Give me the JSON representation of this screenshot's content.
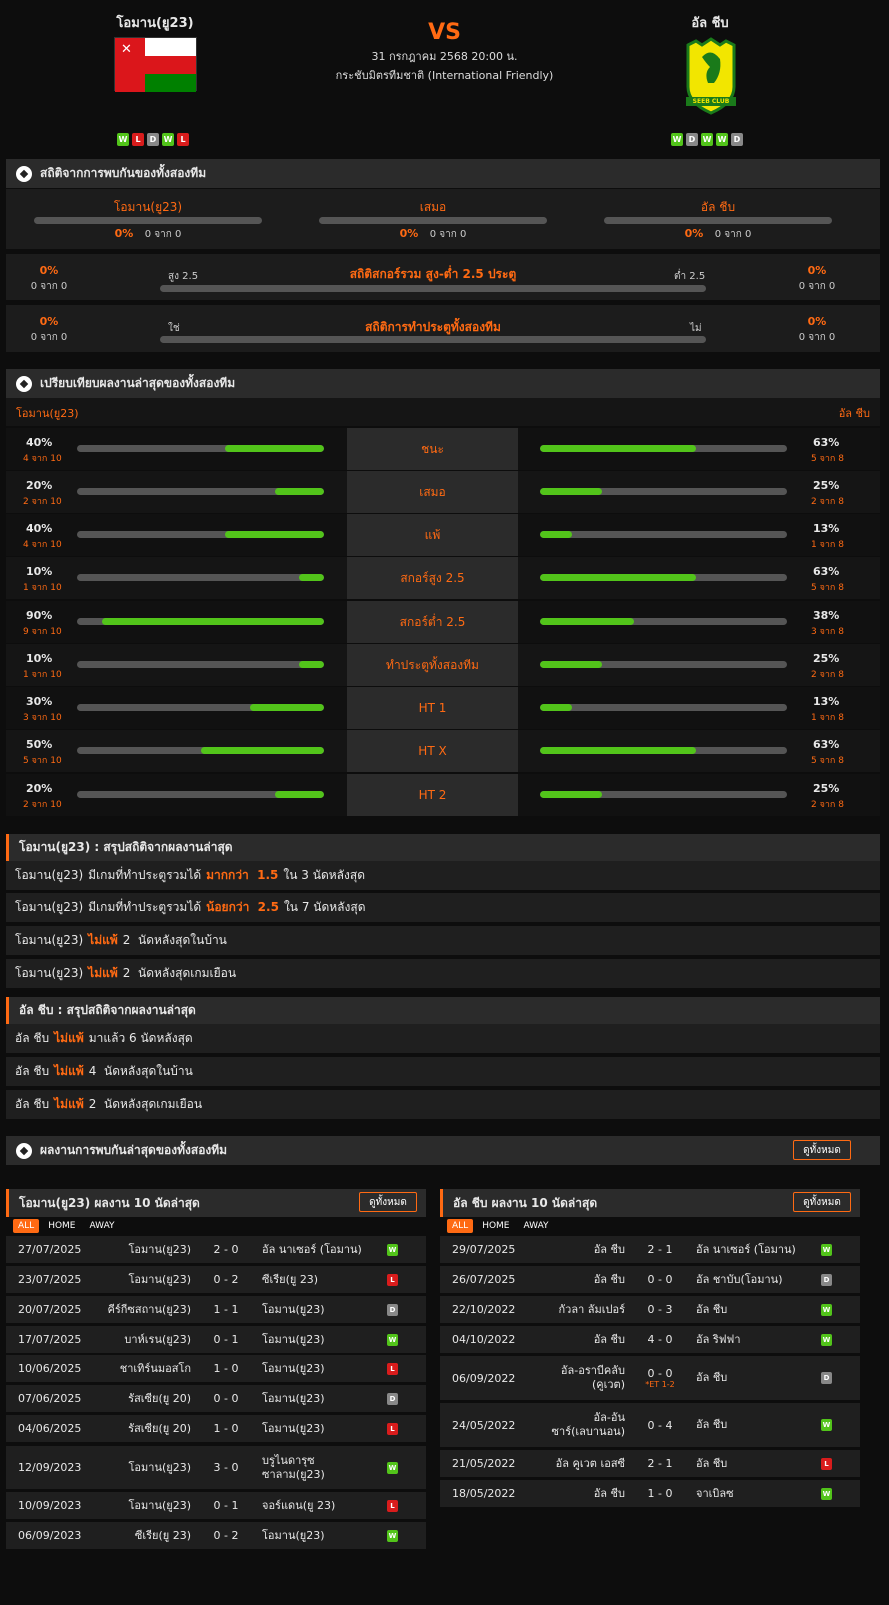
{
  "header": {
    "home_team": "โอมาน(ยู23)",
    "away_team": "อัล ชีบ",
    "vs": "VS",
    "datetime": "31 กรกฎาคม 2568 20:00 น.",
    "competition": "กระชับมิตรทีมชาติ (International Friendly)",
    "home_form": [
      "W",
      "L",
      "D",
      "W",
      "L"
    ],
    "away_form": [
      "W",
      "D",
      "W",
      "W",
      "D"
    ],
    "away_logo_text": "SEEB CLUB"
  },
  "h2h": {
    "title": "สถิติจากการพบกันของทั้งสองทีม",
    "home_label": "โอมาน(ยู23)",
    "draw_label": "เสมอ",
    "away_label": "อัล ชีบ",
    "home_pct": "0%",
    "home_cnt": "0 จาก 0",
    "draw_pct": "0%",
    "draw_cnt": "0 จาก 0",
    "away_pct": "0%",
    "away_cnt": "0 จาก 0",
    "ou_title": "สถิติสกอร์รวม สูง-ต่ำ 2.5 ประตู",
    "ou_left": "สูง 2.5",
    "ou_right": "ต่ำ 2.5",
    "ou_lpct": "0%",
    "ou_lcnt": "0 จาก 0",
    "ou_rpct": "0%",
    "ou_rcnt": "0 จาก 0",
    "btts_title": "สถิติการทำประตูทั้งสองทีม",
    "btts_left": "ใช่",
    "btts_right": "ไม่",
    "btts_lpct": "0%",
    "btts_lcnt": "0 จาก 0",
    "btts_rpct": "0%",
    "btts_rcnt": "0 จาก 0"
  },
  "compare": {
    "title": "เปรียบเทียบผลงานล่าสุดของทั้งสองทีม",
    "home_label": "โอมาน(ยู23)",
    "away_label": "อัล ชีบ",
    "rows": [
      {
        "label": "ชนะ",
        "hp": "40%",
        "hc": "4 จาก 10",
        "hv": 0.4,
        "ap": "63%",
        "ac": "5 จาก 8",
        "av": 0.63
      },
      {
        "label": "เสมอ",
        "hp": "20%",
        "hc": "2 จาก 10",
        "hv": 0.2,
        "ap": "25%",
        "ac": "2 จาก 8",
        "av": 0.25
      },
      {
        "label": "แพ้",
        "hp": "40%",
        "hc": "4 จาก 10",
        "hv": 0.4,
        "ap": "13%",
        "ac": "1 จาก 8",
        "av": 0.13
      },
      {
        "label": "สกอร์สูง 2.5",
        "hp": "10%",
        "hc": "1 จาก 10",
        "hv": 0.1,
        "ap": "63%",
        "ac": "5 จาก 8",
        "av": 0.63
      },
      {
        "label": "สกอร์ต่ำ 2.5",
        "hp": "90%",
        "hc": "9 จาก 10",
        "hv": 0.9,
        "ap": "38%",
        "ac": "3 จาก 8",
        "av": 0.38
      },
      {
        "label": "ทำประตูทั้งสองทีม",
        "hp": "10%",
        "hc": "1 จาก 10",
        "hv": 0.1,
        "ap": "25%",
        "ac": "2 จาก 8",
        "av": 0.25
      },
      {
        "label": "HT 1",
        "hp": "30%",
        "hc": "3 จาก 10",
        "hv": 0.3,
        "ap": "13%",
        "ac": "1 จาก 8",
        "av": 0.13
      },
      {
        "label": "HT X",
        "hp": "50%",
        "hc": "5 จาก 10",
        "hv": 0.5,
        "ap": "63%",
        "ac": "5 จาก 8",
        "av": 0.63
      },
      {
        "label": "HT 2",
        "hp": "20%",
        "hc": "2 จาก 10",
        "hv": 0.2,
        "ap": "25%",
        "ac": "2 จาก 8",
        "av": 0.25
      }
    ]
  },
  "home_summary": {
    "title": "โอมาน(ยู23) : สรุปสถิติจากผลงานล่าสุด",
    "rows": [
      {
        "a": "โอมาน(ยู23)",
        "b": "มีเกมที่ทำประตูรวมได้",
        "hl": "มากกว่า  1.5",
        "c": "ใน 3 นัดหลังสุด"
      },
      {
        "a": "โอมาน(ยู23)",
        "b": "มีเกมที่ทำประตูรวมได้",
        "hl": "น้อยกว่า  2.5",
        "c": "ใน 7 นัดหลังสุด"
      },
      {
        "a": "โอมาน(ยู23)",
        "b": "",
        "hl": "ไม่แพ้",
        "c": "2  นัดหลังสุดในบ้าน"
      },
      {
        "a": "โอมาน(ยู23)",
        "b": "",
        "hl": "ไม่แพ้",
        "c": "2  นัดหลังสุดเกมเยือน"
      }
    ]
  },
  "away_summary": {
    "title": "อัล ชีบ : สรุปสถิติจากผลงานล่าสุด",
    "rows": [
      {
        "a": "อัล ชีบ",
        "hl": "ไม่แพ้",
        "c": "มาแล้ว 6 นัดหลังสุด"
      },
      {
        "a": "อัล ชีบ",
        "hl": "ไม่แพ้",
        "c": "4  นัดหลังสุดในบ้าน"
      },
      {
        "a": "อัล ชีบ",
        "hl": "ไม่แพ้",
        "c": "2  นัดหลังสุดเกมเยือน"
      }
    ]
  },
  "recent": {
    "title": "ผลงานการพบกันล่าสุดของทั้งสองทีม",
    "view_all": "ดูทั้งหมด",
    "home_title": "โอมาน(ยู23) ผลงาน 10 นัดล่าสุด",
    "away_title": "อัล ชีบ ผลงาน 10 นัดล่าสุด",
    "tab_all": "ALL",
    "tab_home": "HOME",
    "tab_away": "AWAY",
    "home_results": [
      {
        "date": "27/07/2025",
        "home": "โอมาน(ยู23)",
        "score": "2 - 0",
        "away": "อัล นาเซอร์ (โอมาน)",
        "r": "W"
      },
      {
        "date": "23/07/2025",
        "home": "โอมาน(ยู23)",
        "score": "0 - 2",
        "away": "ซีเรีย(ยู 23)",
        "r": "L"
      },
      {
        "date": "20/07/2025",
        "home": "คีร์กีซสถาน(ยู23)",
        "score": "1 - 1",
        "away": "โอมาน(ยู23)",
        "r": "D"
      },
      {
        "date": "17/07/2025",
        "home": "บาห์เรน(ยู23)",
        "score": "0 - 1",
        "away": "โอมาน(ยู23)",
        "r": "W"
      },
      {
        "date": "10/06/2025",
        "home": "ชาเทิร์นมอสโก",
        "score": "1 - 0",
        "away": "โอมาน(ยู23)",
        "r": "L"
      },
      {
        "date": "07/06/2025",
        "home": "รัสเซีย(ยู 20)",
        "score": "0 - 0",
        "away": "โอมาน(ยู23)",
        "r": "D"
      },
      {
        "date": "04/06/2025",
        "home": "รัสเซีย(ยู 20)",
        "score": "1 - 0",
        "away": "โอมาน(ยู23)",
        "r": "L"
      },
      {
        "date": "12/09/2023",
        "home": "โอมาน(ยู23)",
        "score": "3 - 0",
        "away": "บรูไนดารุซ ซาลาม(ยู23)",
        "r": "W"
      },
      {
        "date": "10/09/2023",
        "home": "โอมาน(ยู23)",
        "score": "0 - 1",
        "away": "จอร์แดน(ยู 23)",
        "r": "L"
      },
      {
        "date": "06/09/2023",
        "home": "ซีเรีย(ยู 23)",
        "score": "0 - 2",
        "away": "โอมาน(ยู23)",
        "r": "W"
      }
    ],
    "away_results": [
      {
        "date": "29/07/2025",
        "home": "อัล ชีบ",
        "score": "2 - 1",
        "away": "อัล นาเซอร์ (โอมาน)",
        "r": "W"
      },
      {
        "date": "26/07/2025",
        "home": "อัล ชีบ",
        "score": "0 - 0",
        "away": "อัล ชาบับ(โอมาน)",
        "r": "D"
      },
      {
        "date": "22/10/2022",
        "home": "กัวลา ลัมเปอร์",
        "score": "0 - 3",
        "away": "อัล ชีบ",
        "r": "W"
      },
      {
        "date": "04/10/2022",
        "home": "อัล ชีบ",
        "score": "4 - 0",
        "away": "อัล ริฟฟา",
        "r": "W"
      },
      {
        "date": "06/09/2022",
        "home": "อัล-อราบีคลับ (คูเวต)",
        "score": "0 - 0",
        "note": "*ET 1-2",
        "away": "อัล ชีบ",
        "r": "D"
      },
      {
        "date": "24/05/2022",
        "home": "อัล-อันซาร์(เลบานอน)",
        "score": "0 - 4",
        "away": "อัล ชีบ",
        "r": "W"
      },
      {
        "date": "21/05/2022",
        "home": "อัล คูเวต เอสซี",
        "score": "2 - 1",
        "away": "อัล ชีบ",
        "r": "L"
      },
      {
        "date": "18/05/2022",
        "home": "อัล ชีบ",
        "score": "1 - 0",
        "away": "จาเบิลซ",
        "r": "W"
      }
    ]
  }
}
